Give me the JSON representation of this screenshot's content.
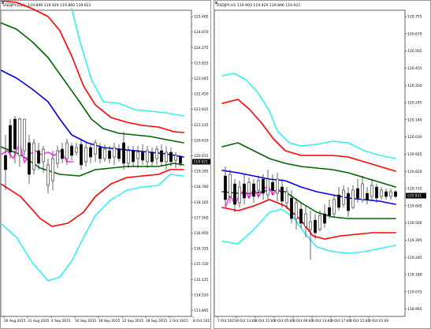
{
  "charts": [
    {
      "id": "daily",
      "title": "USDJPY,Daily  119.899 119.929 119.860 119.921",
      "price_label": "119.921",
      "y_ticks": [
        "125.465",
        "124.870",
        "124.275",
        "123.655",
        "123.045",
        "122.450",
        "121.835",
        "121.125",
        "120.610",
        "120.015",
        "119.395",
        "118.780",
        "118.165",
        "117.560",
        "116.950",
        "116.335",
        "115.720",
        "115.125",
        "114.510",
        "113.895"
      ],
      "x_ticks": [
        "26 Aug 2015",
        "31 Aug 2015",
        "4 Sep 2015",
        "10 Sep 2015",
        "16 Sep 2015",
        "22 Sep 2015",
        "28 Sep 2015",
        "2 Oct 2015",
        "8 Oct 2015"
      ],
      "colors": {
        "blue": "#0000ee",
        "green": "#006400",
        "red": "#ff0000",
        "cyan": "#33f0f0",
        "magenta": "#ff33ff",
        "candle": "#000000"
      }
    },
    {
      "id": "h1",
      "title": "USDJPY,H1  119.903 119.929 119.896 119.921",
      "price_label": "119.921",
      "y_ticks": [
        "120.775",
        "120.670",
        "120.565",
        "120.455",
        "120.350",
        "120.245",
        "120.140",
        "120.030",
        "119.925",
        "119.820",
        "119.710",
        "119.605",
        "119.500",
        "119.395",
        "119.285",
        "119.180",
        "119.075",
        "118.965"
      ],
      "x_ticks": [
        "7 Oct 2015",
        "8 Oct 13:00",
        "8 Oct 21:00",
        "9 Oct 05:00",
        "9 Oct 09:00",
        "9 Oct 13:00",
        "9 Oct 17:00",
        "9 Oct 21:00",
        "9 Oct 01:00"
      ],
      "colors": {
        "blue": "#0000ee",
        "green": "#006400",
        "red": "#ff0000",
        "cyan": "#33f0f0",
        "magenta": "#ff33ff",
        "candle": "#000000"
      }
    }
  ]
}
